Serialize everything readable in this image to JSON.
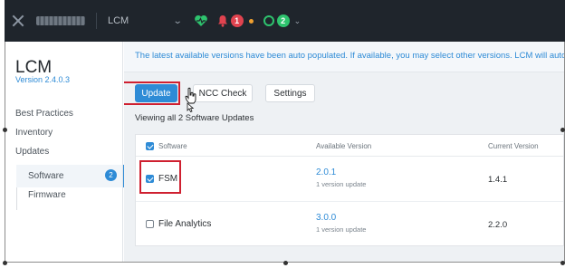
{
  "topbar": {
    "app_name": "LCM",
    "alerts_count": "1",
    "tasks_count": "2"
  },
  "sidebar": {
    "title": "LCM",
    "version": "Version 2.4.0.3",
    "items": [
      {
        "label": "Best Practices"
      },
      {
        "label": "Inventory"
      },
      {
        "label": "Updates"
      }
    ],
    "sub_items": [
      {
        "label": "Software",
        "count": "2",
        "active": true
      },
      {
        "label": "Firmware"
      }
    ]
  },
  "main": {
    "banner": "The latest available versions have been auto populated. If available, you may select other versions. LCM will auto-se",
    "buttons": {
      "update": "Update",
      "ncc_check": "NCC Check",
      "settings": "Settings"
    },
    "viewing": "Viewing all 2 Software Updates",
    "table": {
      "columns": [
        "Software",
        "Available Version",
        "Current Version"
      ],
      "rows": [
        {
          "name": "FSM",
          "checked": true,
          "available": "2.0.1",
          "note": "1 version update",
          "current": "1.4.1"
        },
        {
          "name": "File Analytics",
          "checked": false,
          "available": "3.0.0",
          "note": "1 version update",
          "current": "2.2.0"
        }
      ]
    }
  },
  "colors": {
    "accent": "#2e8bd6",
    "highlight_box": "#cf2030",
    "topbar": "#1f252c"
  }
}
